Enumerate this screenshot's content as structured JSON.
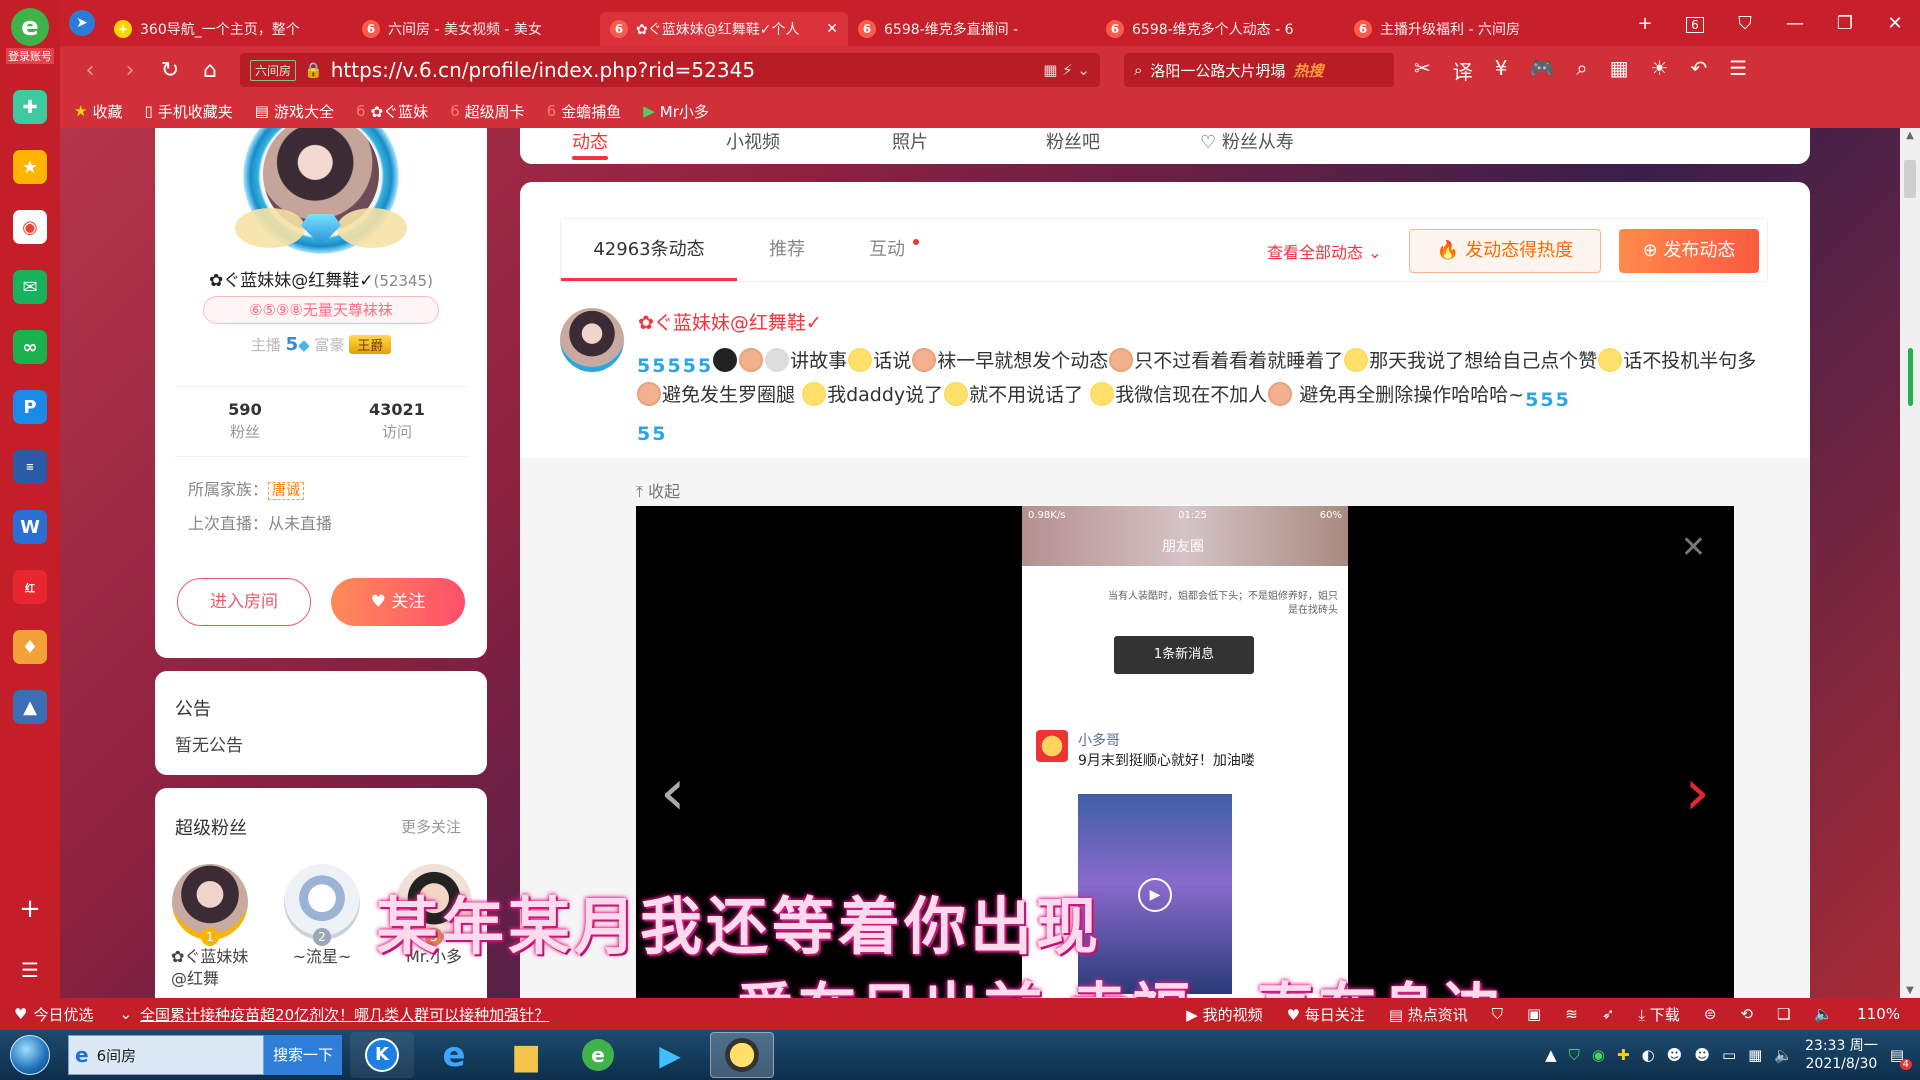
{
  "browser": {
    "tabs": [
      {
        "label": "360导航_一个主页，整个",
        "icon": "360-icon",
        "color": "#ffd400",
        "active": false
      },
      {
        "label": "六间房 - 美女视频 - 美女",
        "icon": "six-icon",
        "color": "#ff5a4a",
        "active": false
      },
      {
        "label": "✿ぐ蓝妹妹@红舞鞋✓个人",
        "icon": "six-icon",
        "color": "#ff5a4a",
        "active": true
      },
      {
        "label": "6598-维克多直播间 - ",
        "icon": "six-icon",
        "color": "#ff5a4a",
        "active": false
      },
      {
        "label": "6598-维克多个人动态 - 6",
        "icon": "six-icon",
        "color": "#ff5a4a",
        "active": false
      },
      {
        "label": "主播升级福利 - 六间房",
        "icon": "six-icon",
        "color": "#ff5a4a",
        "active": false
      }
    ],
    "tab_counter": "6",
    "url_badge": "六间房",
    "url": "https://v.6.cn/profile/index.php?rid=52345",
    "search_text": "洛阳一公路大片坍塌",
    "search_hot": "热搜",
    "bookmarks": [
      {
        "label": "收藏",
        "icon": "star-icon"
      },
      {
        "label": "手机收藏夹",
        "icon": "phone-icon"
      },
      {
        "label": "游戏大全",
        "icon": "doc-icon"
      },
      {
        "label": "✿ぐ蓝妹",
        "icon": "six-icon"
      },
      {
        "label": "超级周卡",
        "icon": "six-icon"
      },
      {
        "label": "金蟾捕鱼",
        "icon": "six-icon"
      },
      {
        "label": "Mr小多",
        "icon": "play-icon"
      }
    ]
  },
  "dock": {
    "login_label": "登录账号"
  },
  "profile": {
    "name": "✿ぐ蓝妹妹@红舞鞋✓",
    "rid": "(52345)",
    "fan_badge": "⑥⑤⑨⑧无量天尊袜袜",
    "anchor_label": "主播",
    "anchor_level": "5",
    "rich_label": "富豪",
    "rank_badge": "王爵",
    "fans_count": "590",
    "fans_label": "粉丝",
    "visits_count": "43021",
    "visits_label": "访问",
    "family_label": "所属家族：",
    "family_value": "唐诚",
    "last_live": "上次直播：从未直播",
    "enter_room": "进入房间",
    "follow": "关注"
  },
  "notice": {
    "title": "公告",
    "text": "暂无公告"
  },
  "super_fans": {
    "title": "超级粉丝",
    "more": "更多关注",
    "fans": [
      {
        "rank": "1",
        "name": "✿ぐ蓝妹妹@红舞",
        "rank_color": "#f7b500"
      },
      {
        "rank": "2",
        "name": "~流星~",
        "rank_color": "#9aa7b8"
      },
      {
        "rank": "3",
        "name": "Mr.小多",
        "rank_color": "#d78a4d"
      }
    ]
  },
  "nav": {
    "items": [
      "动态",
      "小视频",
      "照片",
      "粉丝吧",
      "粉丝从寿"
    ]
  },
  "feed": {
    "tabs": [
      "42963条动态",
      "推荐",
      "互动"
    ],
    "view_all": "查看全部动态",
    "heat_btn": "发动态得热度",
    "post_btn": "发布动态",
    "post": {
      "author": "✿ぐ蓝妹妹@红舞鞋✓",
      "text_1": "讲故事",
      "text_2": "话说",
      "text_3": "袜一早就想发个动态",
      "text_4": "只不过看着看着就睡着了",
      "text_5": "那天我说了想给自己点个赞",
      "text_6": "话不投机半句多",
      "text_7": "避免发生罗圈腿",
      "text_8": "我daddy说了",
      "text_9": "就不用说话了",
      "text_10": "我微信现在不加人",
      "text_11": "避免再全删除操作哈哈哈~",
      "five": "5"
    },
    "collapse": "收起",
    "phone": {
      "status_left": "0.98K/s",
      "status_mid": "01:25",
      "status_right": "60%",
      "moments_title": "朋友圈",
      "note": "当有人装酷时，姐都会低下头；不是姐修养好，姐只是在找砖头",
      "new_message": "1条新消息",
      "user": "小多哥",
      "message": "9月末到挺顺心就好！加油喽"
    }
  },
  "lyrics": {
    "line1": "某年某月我还等着你出现",
    "line2": "爱在日出前  幸福一直在身边"
  },
  "statusbar": {
    "left": "今日优选",
    "news": "全国累计接种疫苗超20亿剂次！哪几类人群可以接种加强针？",
    "items": [
      "我的视频",
      "每日关注",
      "热点资讯",
      "下载"
    ],
    "zoom": "110%"
  },
  "taskbar": {
    "ie_label": "6间房",
    "search_btn": "搜索一下",
    "time": "23:33 周一",
    "date": "2021/8/30",
    "notif_count": "4"
  }
}
